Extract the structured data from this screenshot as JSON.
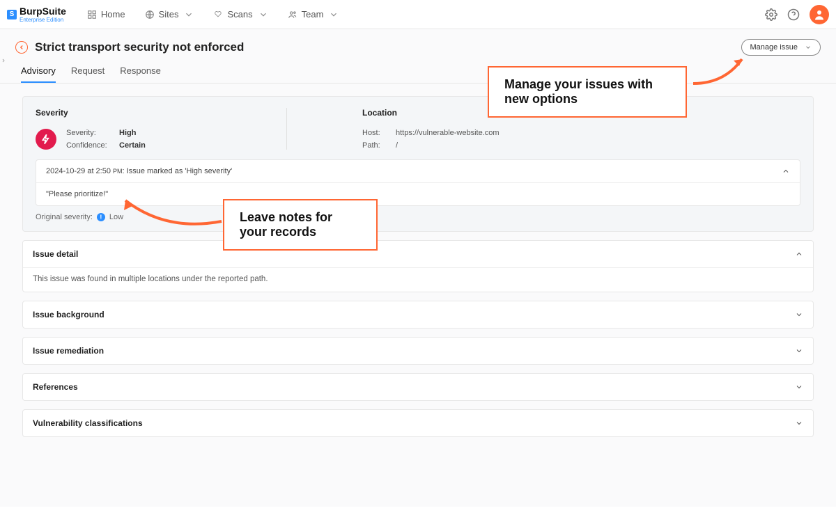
{
  "brand": {
    "name": "BurpSuite",
    "edition": "Enterprise Edition"
  },
  "nav": {
    "items": [
      {
        "label": "Home"
      },
      {
        "label": "Sites"
      },
      {
        "label": "Scans"
      },
      {
        "label": "Team"
      }
    ]
  },
  "issue": {
    "title": "Strict transport security not enforced",
    "manage_btn": "Manage issue",
    "tabs": [
      "Advisory",
      "Request",
      "Response"
    ],
    "active_tab": 0
  },
  "severity_panel": {
    "heading": "Severity",
    "severity_label": "Severity:",
    "severity_value": "High",
    "confidence_label": "Confidence:",
    "confidence_value": "Certain"
  },
  "location_panel": {
    "heading": "Location",
    "host_label": "Host:",
    "host_value": "https://vulnerable-website.com",
    "path_label": "Path:",
    "path_value": "/"
  },
  "history": {
    "summary_prefix": "2024-10-29 at 2:50 ",
    "summary_pm": "PM",
    "summary_suffix": ": Issue marked as 'High severity'",
    "note": "\"Please prioritize!\"",
    "orig_label": "Original severity:",
    "orig_value": "Low"
  },
  "sections": {
    "issue_detail": {
      "title": "Issue detail",
      "body": "This issue was found in multiple locations under the reported path."
    },
    "issue_background": {
      "title": "Issue background"
    },
    "issue_remediation": {
      "title": "Issue remediation"
    },
    "references": {
      "title": "References"
    },
    "vuln_class": {
      "title": "Vulnerability classifications"
    }
  },
  "callouts": {
    "manage": "Manage your issues with new options",
    "notes": "Leave notes for your records"
  }
}
